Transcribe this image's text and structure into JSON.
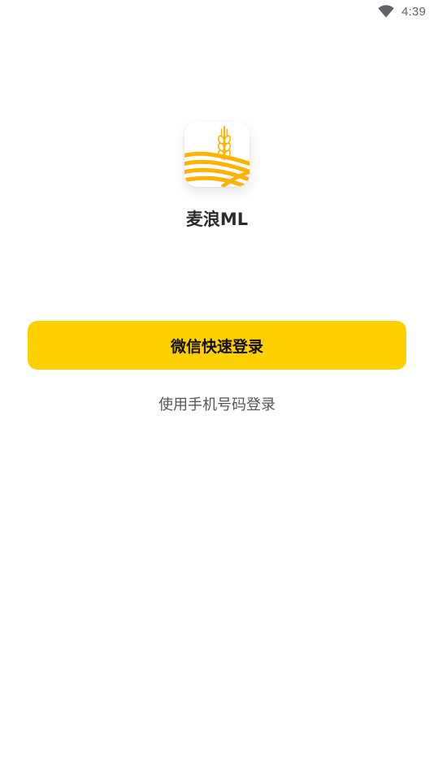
{
  "status_bar": {
    "time": "4:39",
    "wifi_icon": "wifi-icon"
  },
  "app": {
    "logo_icon": "wheat-field-logo-icon",
    "name": "麦浪ML",
    "brand_color": "#FFB300"
  },
  "actions": {
    "wechat_login_label": "微信快速登录",
    "wechat_button_color": "#FFD000",
    "phone_login_label": "使用手机号码登录"
  }
}
